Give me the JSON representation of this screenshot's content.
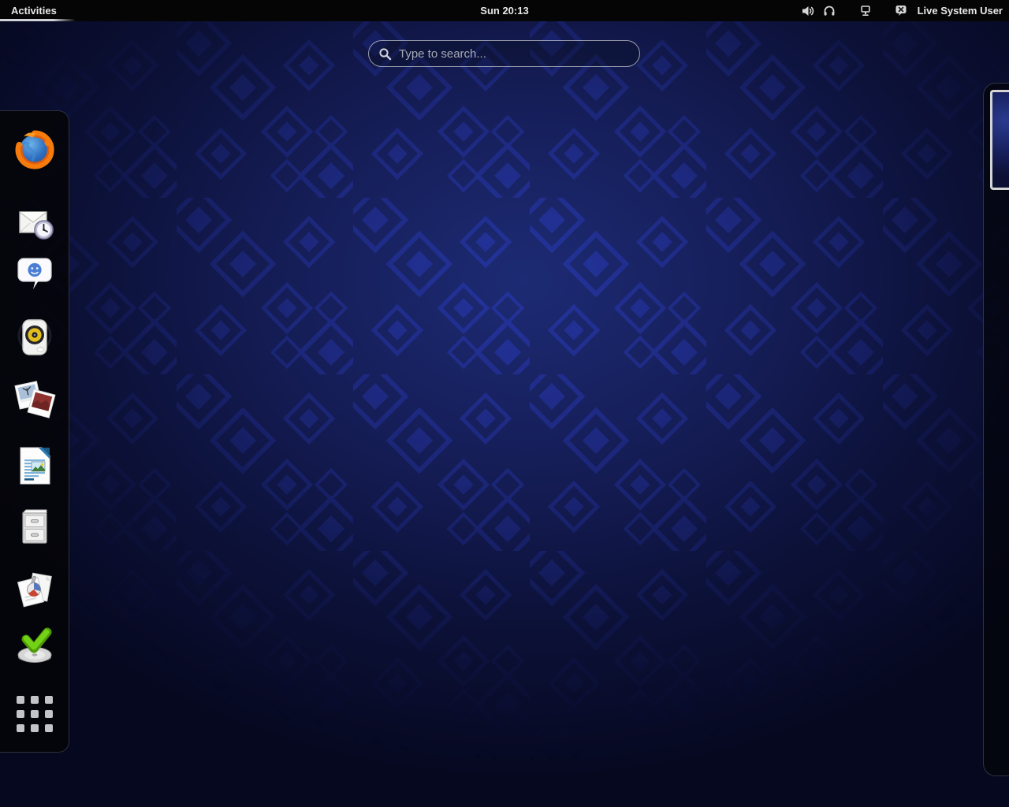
{
  "top_bar": {
    "activities_label": "Activities",
    "clock": "Sun 20:13",
    "user_name": "Live System User",
    "status_icons": [
      "volume-icon",
      "headphones-icon",
      "network-icon",
      "chat-status-offline-icon"
    ]
  },
  "search": {
    "placeholder": "Type to search..."
  },
  "dash": {
    "items": [
      "firefox",
      "evolution-mail",
      "empathy-chat",
      "rhythmbox-music",
      "shotwell-photos",
      "libreoffice-writer",
      "files",
      "documents",
      "install-to-disk",
      "show-applications"
    ]
  },
  "workspaces": {
    "visible_thumbnails": 1
  },
  "colors": {
    "topbar_bg": "#050505",
    "wallpaper_center": "#1d2b74",
    "wallpaper_edge": "#06081f",
    "pattern_blue": "#2b3cc4",
    "dash_bg": "rgba(4,4,8,0.88)",
    "search_border": "#e6ebf0",
    "installer_check_green": "#73d216"
  }
}
